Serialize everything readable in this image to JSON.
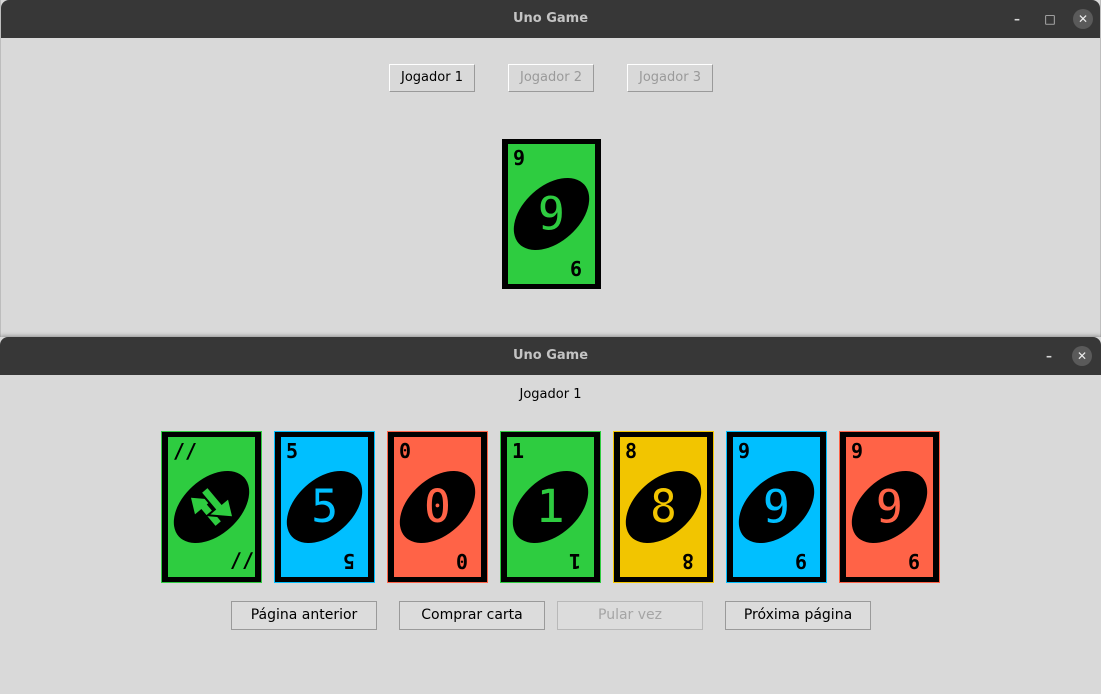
{
  "top_window": {
    "title": "Uno Game",
    "tabs": [
      {
        "label": "Jogador 1",
        "active": true
      },
      {
        "label": "Jogador 2",
        "active": false
      },
      {
        "label": "Jogador 3",
        "active": false
      }
    ],
    "discard_card": {
      "color": "#2ecc40",
      "value": "9"
    }
  },
  "bottom_window": {
    "title": "Uno Game",
    "player_label": "Jogador 1",
    "hand": [
      {
        "color": "#2ecc40",
        "value": "reverse",
        "corner": "⇗"
      },
      {
        "color": "#00bfff",
        "value": "5"
      },
      {
        "color": "#ff6347",
        "value": "0"
      },
      {
        "color": "#2ecc40",
        "value": "1"
      },
      {
        "color": "#f2c500",
        "value": "8"
      },
      {
        "color": "#00bfff",
        "value": "9"
      },
      {
        "color": "#ff6347",
        "value": "9"
      }
    ],
    "buttons": {
      "previous": "Página anterior",
      "draw": "Comprar carta",
      "skip": "Pular vez",
      "next": "Próxima página"
    }
  },
  "window_controls": {
    "minimize": "–",
    "maximize": "□",
    "close": "✕"
  }
}
